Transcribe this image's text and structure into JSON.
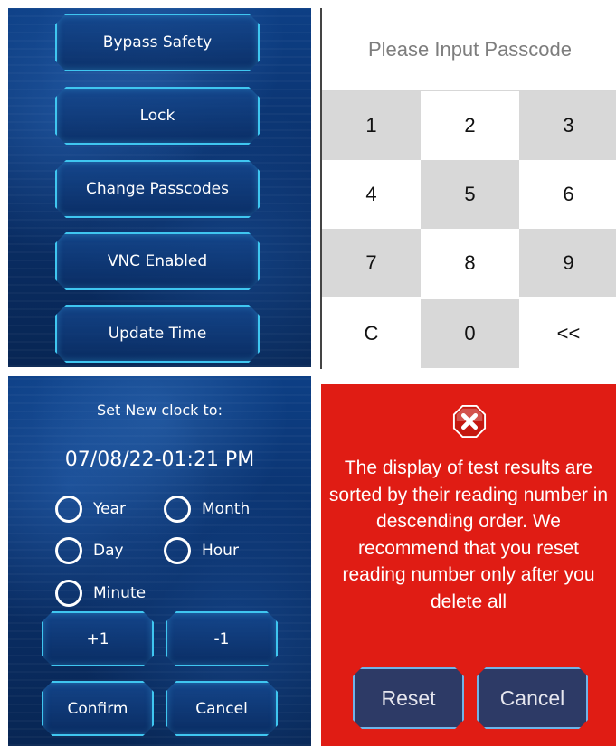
{
  "menu": {
    "items": [
      "Bypass Safety",
      "Lock",
      "Change Passcodes",
      "VNC Enabled",
      "Update Time"
    ]
  },
  "keypad": {
    "placeholder": "Please Input Passcode",
    "value": "",
    "keys": [
      "1",
      "2",
      "3",
      "4",
      "5",
      "6",
      "7",
      "8",
      "9",
      "C",
      "0",
      "<<"
    ]
  },
  "clock": {
    "title": "Set New clock to:",
    "time": "07/08/22-01:21 PM",
    "options": [
      "Year",
      "Month",
      "Day",
      "Hour",
      "Minute"
    ],
    "plus_label": "+1",
    "minus_label": "-1",
    "confirm_label": "Confirm",
    "cancel_label": "Cancel"
  },
  "error": {
    "icon": "error-x-icon",
    "message": "The display of test results are sorted by their reading number in descending order. We recommend that you reset reading number only after you delete all",
    "reset_label": "Reset",
    "cancel_label": "Cancel",
    "background_color": "#e01c14"
  },
  "colors": {
    "accent_glow": "#3fc6f0",
    "panel_blue": "#0a2f68",
    "key_gray": "#d8d8d8"
  }
}
